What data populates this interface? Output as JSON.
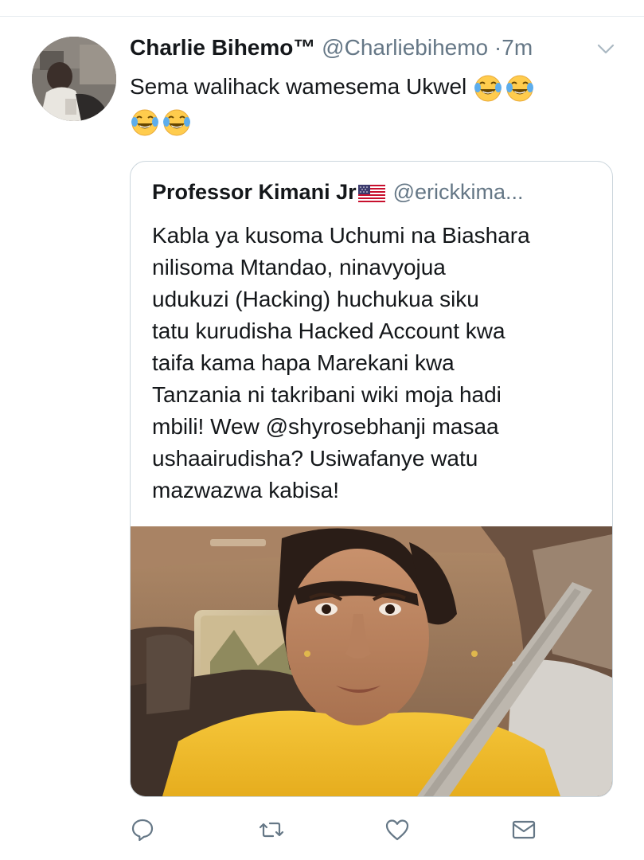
{
  "tweet": {
    "author_name": "Charlie Bihemo™",
    "author_handle": "@Charliebihemo",
    "separator": "·",
    "time": "7m",
    "text": "Sema walihack wamesema Ukwel",
    "emojis": [
      "face-with-tears-of-joy",
      "face-with-tears-of-joy",
      "face-with-tears-of-joy",
      "face-with-tears-of-joy"
    ]
  },
  "quoted_tweet": {
    "author_name": "Professor Kimani Jr",
    "flag": "us-flag",
    "author_handle": "@erickkima...",
    "lines": [
      "Kabla ya kusoma Uchumi na Biashara",
      "nilisoma Mtandao, ninavyojua",
      "udukuzi (Hacking) huchukua siku",
      "tatu kurudisha Hacked Account kwa",
      "taifa kama hapa Marekani kwa",
      "Tanzania ni takribani wiki moja hadi",
      "mbili! Wew @shyrosebhanji masaa",
      "ushaairudisha? Usiwafanye watu",
      "mazwazwa kabisa!"
    ],
    "photo": "selfie-in-car"
  },
  "actions": [
    "reply-icon",
    "retweet-icon",
    "like-icon",
    "direct-message-icon"
  ],
  "colors": {
    "text": "#14171a",
    "secondary": "#657786",
    "border": "#ccd6dd",
    "icon": "#657786"
  }
}
